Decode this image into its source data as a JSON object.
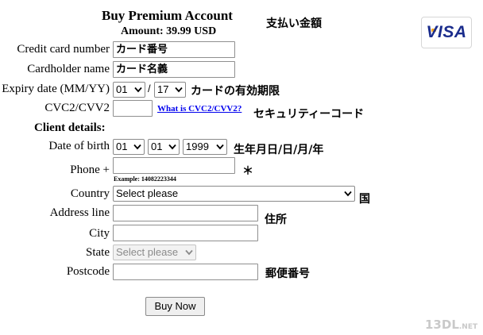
{
  "header": {
    "title": "Buy Premium Account",
    "amount": "Amount: 39.99 USD",
    "amount_note_jp": "支払い金額"
  },
  "card_logo": {
    "brand": "VISA",
    "brand_color": "#1a2c8c",
    "accent_color": "#f7a823"
  },
  "form": {
    "credit_card": {
      "label": "Credit card number",
      "value": "カード番号"
    },
    "cardholder": {
      "label": "Cardholder name",
      "value": "カード名義"
    },
    "expiry": {
      "label": "Expiry date (MM/YY)",
      "month": "01",
      "separator": "/",
      "year": "17",
      "note_jp": "カードの有効期限"
    },
    "cvc": {
      "label": "CVC2/CVV2",
      "value": "",
      "help_link": "What is CVC2/CVV2?",
      "note_jp": "セキュリティーコード"
    },
    "client_heading": "Client details:",
    "birth": {
      "label": "Date of birth",
      "day": "01",
      "month": "01",
      "year": "1999",
      "note_jp": "生年月日/日/月/年"
    },
    "phone": {
      "label": "Phone +",
      "value": "",
      "example": "Example: 14082223344",
      "note_jp": "＊"
    },
    "country": {
      "label": "Country",
      "selected": "Select please",
      "note_jp": "国"
    },
    "address": {
      "label": "Address line",
      "value": "",
      "note_jp": "住所"
    },
    "city": {
      "label": "City",
      "value": ""
    },
    "state": {
      "label": "State",
      "selected": "Select please",
      "disabled": true
    },
    "postcode": {
      "label": "Postcode",
      "value": "",
      "note_jp": "郵便番号"
    },
    "submit_label": "Buy Now"
  },
  "watermark": {
    "main": "13DL",
    "suffix": ".NET"
  }
}
